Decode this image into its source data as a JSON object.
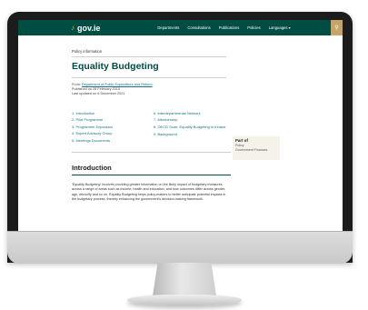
{
  "header": {
    "logo_text": "gov.ie",
    "nav": [
      "Departments",
      "Consultations",
      "Publications",
      "Policies",
      "Languages ▾"
    ],
    "search_icon": "search-icon"
  },
  "page": {
    "doc_type": "Policy information",
    "title": "Equality Budgeting",
    "from_label": "From: ",
    "from_link": "Department of Public Expenditure and Reform",
    "published": "Published on 28 February 2019",
    "updated": "Last updated on 6 December 2021",
    "toc_left": [
      "1. Introduction",
      "2. Pilot Programme",
      "3. Programme Expansion",
      "4. Expert Advisory Group",
      "5. Meetings Documents"
    ],
    "toc_right": [
      "6. Interdepartmental Network",
      "7. Membership",
      "8. OECD Scan: Equality Budgeting in Ireland",
      "9. Background"
    ],
    "part_of": {
      "title": "Part of",
      "items": [
        "Policy",
        "Government Finances"
      ]
    },
    "section_title": "Introduction",
    "intro_text": "'Equality Budgeting' involves providing greater information on the likely impact of budgetary measures across a range of areas such as income, health and education, and how outcomes differ across gender, age, ethnicity and so on. Equality Budgeting helps policy-makers to better anticipate potential impacts in the budgetary process, thereby enhancing the government's decision-making framework."
  }
}
